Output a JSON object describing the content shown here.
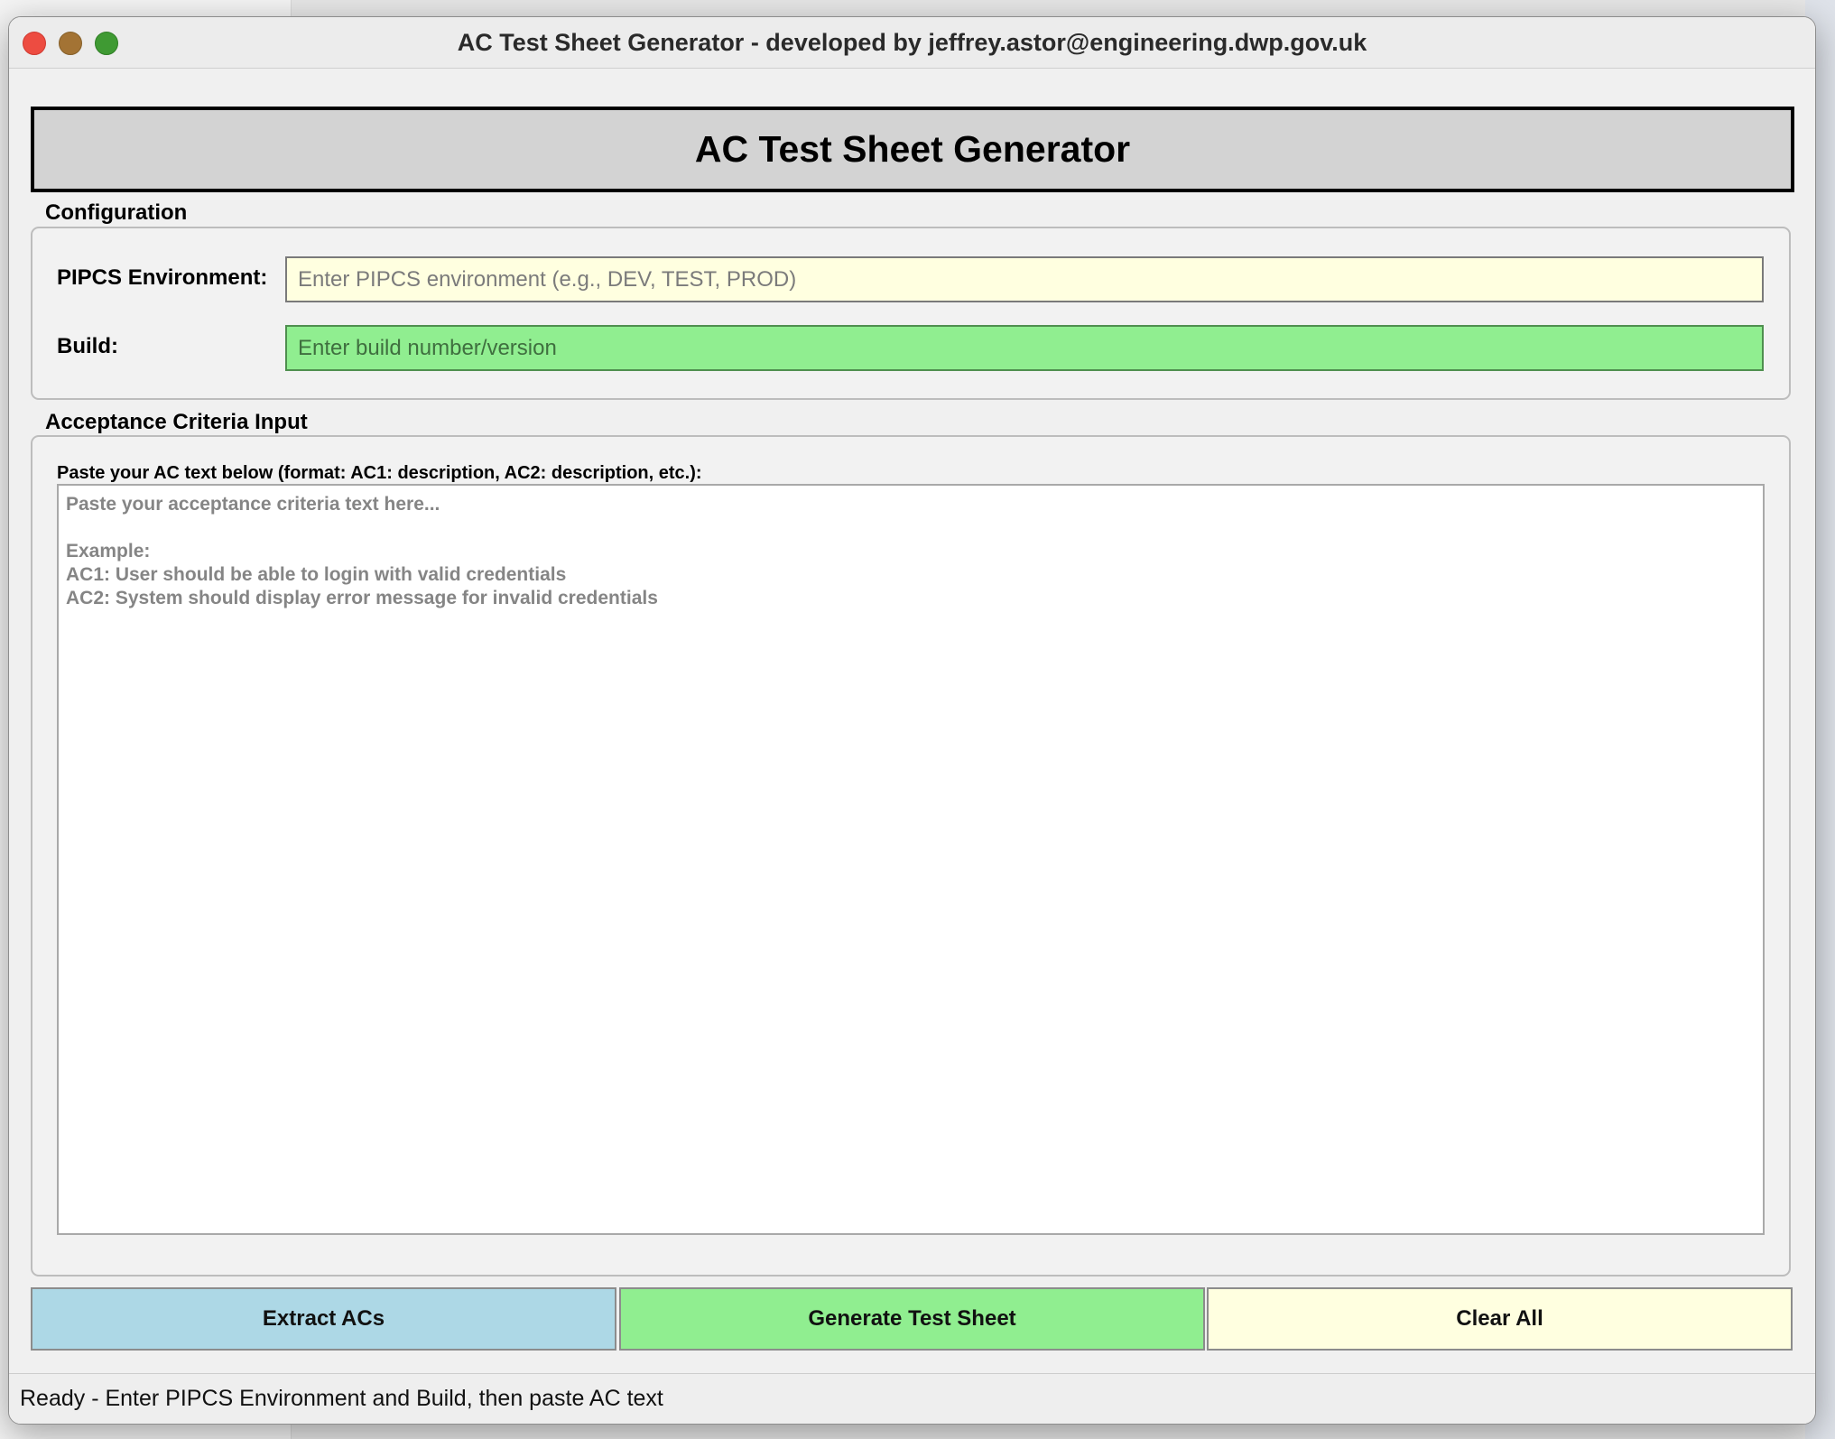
{
  "window": {
    "title": "AC Test Sheet Generator - developed by jeffrey.astor@engineering.dwp.gov.uk"
  },
  "app": {
    "heading": "AC Test Sheet Generator"
  },
  "configuration": {
    "group_label": "Configuration",
    "env_label": "PIPCS Environment:",
    "env_value": "",
    "env_placeholder": "Enter PIPCS environment (e.g., DEV, TEST, PROD)",
    "build_label": "Build:",
    "build_value": "",
    "build_placeholder": "Enter build number/version"
  },
  "ac_input": {
    "group_label": "Acceptance Criteria Input",
    "hint": "Paste your AC text below (format: AC1: description, AC2: description, etc.):",
    "value": "",
    "placeholder": "Paste your acceptance criteria text here...\n\nExample:\nAC1: User should be able to login with valid credentials\nAC2: System should display error message for invalid credentials"
  },
  "buttons": {
    "extract_label": "Extract ACs",
    "generate_label": "Generate Test Sheet",
    "clear_label": "Clear All"
  },
  "status": {
    "text": "Ready - Enter PIPCS Environment and Build, then paste AC text"
  },
  "colors": {
    "extract_button": "#add8e6",
    "generate_button": "#90ee90",
    "clear_button": "#ffffe0",
    "env_input": "#ffffe0",
    "build_input": "#90ee90",
    "banner": "#d3d3d3"
  }
}
